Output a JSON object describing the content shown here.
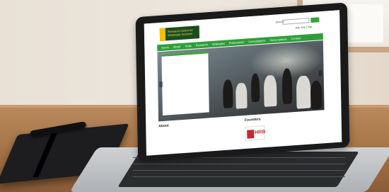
{
  "site": {
    "logo_text": "Research Centre for Wholesale Services",
    "search_label": "Search",
    "search_placeholder": "",
    "search_button": "",
    "header_link": "Ask Ask Chat",
    "nav": [
      "Home",
      "About",
      "Visits",
      "Research",
      "Strategies",
      "Publications",
      "Consultations",
      "Subscriptions",
      "Contact"
    ],
    "hero_caption_title": "",
    "hero_caption_body": "",
    "about_title": "About",
    "about_text": "",
    "founders_title": "Founders",
    "founder_logo_text": "HRB",
    "founder_desc": ""
  },
  "colors": {
    "brand_green": "#2f9e3a",
    "logo_dark": "#1a4d1f",
    "logo_yellow": "#f0c400",
    "hrb_red": "#c9272d",
    "caption_link": "#1e3ea8"
  }
}
